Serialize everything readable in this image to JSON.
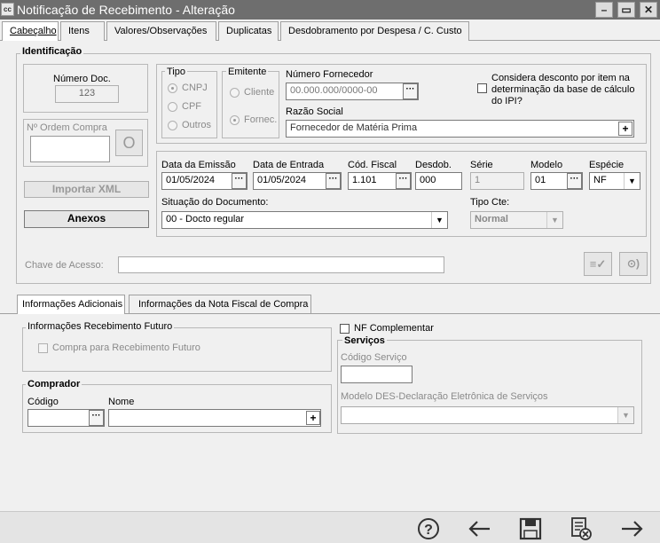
{
  "window": {
    "title": "Notificação de Recebimento - Alteração",
    "app_icon": "cc"
  },
  "tabs": [
    "Cabeçalho",
    "Itens",
    "Valores/Observações",
    "Duplicatas",
    "Desdobramento por Despesa / C. Custo"
  ],
  "ident": {
    "title": "Identificação",
    "numero_doc_label": "Número Doc.",
    "numero_doc_value": "123",
    "ordem_compra_label": "Nº Ordem Compra",
    "ordem_btn": "O",
    "importar_xml": "Importar XML",
    "anexos": "Anexos",
    "tipo": {
      "title": "Tipo",
      "options": [
        "CNPJ",
        "CPF",
        "Outros"
      ],
      "selected": "CNPJ"
    },
    "emitente": {
      "title": "Emitente",
      "options": [
        "Cliente",
        "Fornec."
      ],
      "selected": "Fornec."
    },
    "num_fornecedor_label": "Número Fornecedor",
    "num_fornecedor_placeholder": "00.000.000/0000-00",
    "considera_label_1": "Considera desconto por item na",
    "considera_label_2": "determinação da base de cálculo",
    "considera_label_3": "do IPI?",
    "razao_label": "Razão Social",
    "razao_value": "Fornecedor de Matéria Prima",
    "data_emissao_label": "Data da Emissão",
    "data_emissao": "01/05/2024",
    "data_entrada_label": "Data de Entrada",
    "data_entrada": "01/05/2024",
    "cod_fiscal_label": "Cód. Fiscal",
    "cod_fiscal": "1.101",
    "desdob_label": "Desdob.",
    "desdob": "000",
    "serie_label": "Série",
    "serie": "1",
    "modelo_label": "Modelo",
    "modelo": "01",
    "especie_label": "Espécie",
    "especie": "NF",
    "situacao_label": "Situação do Documento:",
    "situacao": "00 - Docto regular",
    "tipo_cte_label": "Tipo Cte:",
    "tipo_cte": "Normal",
    "chave_label": "Chave de Acesso:"
  },
  "subtabs": [
    "Informações Adicionais",
    "Informações da Nota Fiscal de Compra"
  ],
  "info_futuro": {
    "title": "Informações Recebimento Futuro",
    "compra_label": "Compra para Recebimento Futuro"
  },
  "comprador": {
    "title": "Comprador",
    "codigo_label": "Código",
    "nome_label": "Nome"
  },
  "nf_complementar": "NF Complementar",
  "servicos": {
    "title": "Serviços",
    "codigo_label": "Código Serviço",
    "modelo_label": "Modelo DES-Declaração Eletrônica de Serviços"
  }
}
